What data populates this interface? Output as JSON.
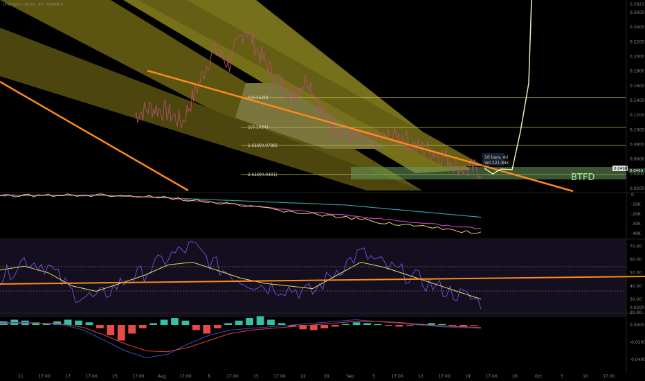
{
  "header": {
    "symbol_text": "Unibright / Tether, 4H, BINANCE"
  },
  "colors": {
    "background": "#000000",
    "price_line": "#b0506a",
    "fan_yellow": "#c8bf3a",
    "trend_orange": "#ff8a1a",
    "fib_line": "#c8bf5a",
    "btfd_zone": "#6a9a5a",
    "projection": "#e8f0c0",
    "indicator_yellow": "#e8d860",
    "indicator_magenta": "#c040c0",
    "indicator_teal": "#30a0a0",
    "rsi_purple": "#6a4ad8",
    "rsi_band": "#140f1f",
    "macd_green": "#36c0a8",
    "macd_red": "#e84a4a"
  },
  "chart_data": [
    {
      "type": "line",
      "name": "price",
      "price_axis_labels": [
        "0.2600",
        "0.2400",
        "0.2200",
        "0.2000",
        "0.1800",
        "0.1600",
        "0.1400",
        "0.1200",
        "0.1000",
        "0.0800",
        "0.0600",
        "0.0400",
        "0.0200"
      ],
      "top_label": "0.2821",
      "x": [
        "11",
        "17:00",
        "17",
        "17:00",
        "25",
        "17:00",
        "Aug",
        "17:00",
        "8",
        "17:00",
        "15",
        "17:00",
        "22",
        "29",
        "Sep",
        "5",
        "17:00",
        "12",
        "17:00",
        "19",
        "17:00",
        "26",
        "Oct",
        "5",
        "10",
        "17:00"
      ],
      "y": [
        0.12,
        0.13,
        0.125,
        0.11,
        0.16,
        0.21,
        0.19,
        0.24,
        0.2,
        0.17,
        0.15,
        0.17,
        0.12,
        0.1,
        0.09,
        0.085,
        0.09,
        0.09,
        0.075,
        0.07,
        0.06,
        0.045,
        0.046
      ],
      "fib_levels": [
        {
          "label": "1(0.1520)",
          "value": 0.144
        },
        {
          "label": "1(0.1034)",
          "value": 0.1034
        },
        {
          "label": "1.618(0.0788)",
          "value": 0.0788
        },
        {
          "label": "2.618(0.0391)",
          "value": 0.0391
        }
      ],
      "current_price_label": "0.04907",
      "current_price_sub": "0.0453",
      "btfd_label": "BTFD",
      "measure_label_1": "16 bars, 4d",
      "measure_label_2": "Vol 221.84K"
    },
    {
      "type": "line",
      "name": "volume-oscillator",
      "axis_labels": [
        "0",
        "-10K",
        "-20K",
        "-30K",
        "-40K"
      ]
    },
    {
      "type": "line",
      "name": "rsi",
      "axis_labels": [
        "70.00",
        "60.00",
        "50.00",
        "40.00",
        "30.00",
        "20.00"
      ],
      "levels": [
        70,
        30
      ],
      "series_rsi": [
        45,
        60,
        55,
        35,
        30,
        42,
        50,
        62,
        70,
        55,
        45,
        40,
        38,
        35,
        52,
        65,
        55,
        48,
        40,
        34,
        28
      ],
      "series_ma": [
        52,
        55,
        50,
        40,
        36,
        42,
        48,
        56,
        58,
        52,
        46,
        42,
        40,
        38,
        48,
        58,
        54,
        48,
        42,
        36,
        30
      ]
    },
    {
      "type": "bar",
      "name": "macd",
      "axis_labels": [
        "0.0200",
        "0.0000",
        "-0.0200",
        "-0.0400"
      ],
      "histogram": [
        0.004,
        0.006,
        0.005,
        0.003,
        0.002,
        0.004,
        0.006,
        0.005,
        0.003,
        -0.004,
        -0.012,
        -0.018,
        -0.01,
        -0.004,
        0.002,
        0.006,
        0.008,
        0.005,
        -0.006,
        -0.01,
        -0.004,
        0.002,
        0.005,
        0.008,
        0.01,
        0.006,
        0.002,
        -0.002,
        -0.005,
        -0.006,
        -0.004,
        -0.002,
        0.001,
        0.003,
        0.002,
        0.001,
        -0.001,
        -0.002,
        -0.001,
        0.001,
        0.002,
        0.001,
        -0.001,
        -0.002,
        -0.001
      ],
      "macd_line": [
        0.002,
        0.003,
        0.002,
        0.0,
        -0.006,
        -0.018,
        -0.03,
        -0.038,
        -0.034,
        -0.022,
        -0.012,
        -0.006,
        -0.004,
        -0.002,
        0.0,
        0.002,
        0.004,
        0.006,
        0.004,
        0.002,
        0.0,
        -0.002,
        -0.003,
        -0.004
      ],
      "signal_line": [
        0.001,
        0.002,
        0.002,
        0.001,
        -0.003,
        -0.012,
        -0.022,
        -0.03,
        -0.031,
        -0.026,
        -0.018,
        -0.01,
        -0.006,
        -0.004,
        -0.002,
        0.0,
        0.002,
        0.004,
        0.004,
        0.003,
        0.001,
        -0.001,
        -0.002,
        -0.003
      ]
    }
  ]
}
